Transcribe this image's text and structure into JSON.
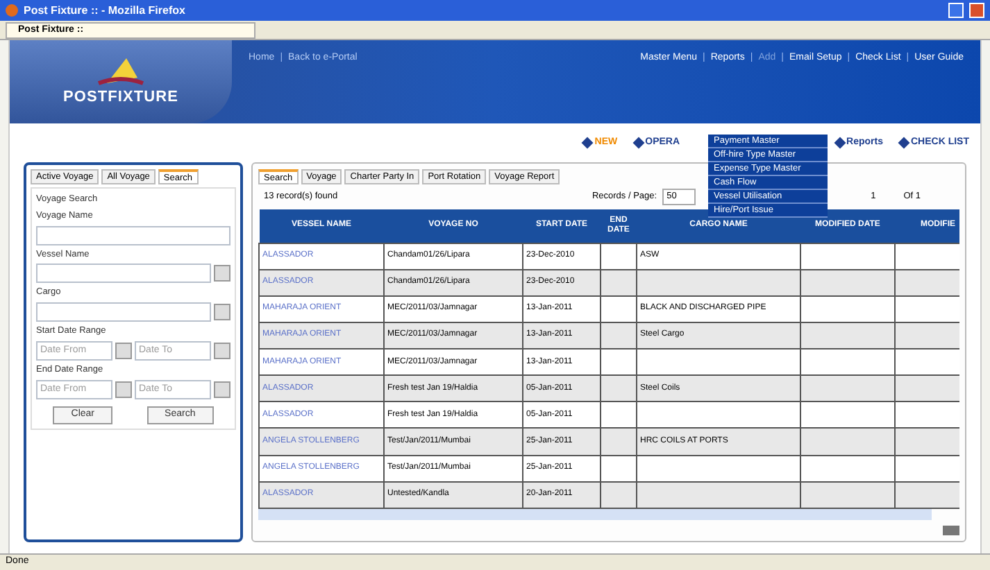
{
  "window": {
    "title": "Post Fixture :: - Mozilla Firefox"
  },
  "browser_tab": {
    "label": "Post Fixture ::"
  },
  "logo": {
    "text": "POSTFIXTURE"
  },
  "header_links": [
    {
      "label": "Home"
    },
    {
      "label": "Back to e-Portal",
      "separator": "|"
    }
  ],
  "main_menu": [
    {
      "label": "Master Menu",
      "expanded": false
    },
    {
      "label": "Reports",
      "expanded": false,
      "separator": "|"
    },
    {
      "label": "Add",
      "expanded": true,
      "separator": "|"
    },
    {
      "label": "Email Setup",
      "expanded": false,
      "separator": "|"
    },
    {
      "label": "Check List",
      "expanded": false,
      "separator": "|"
    },
    {
      "label": "User Guide",
      "expanded": false,
      "separator": "|"
    }
  ],
  "dropdown": [
    "Payment Master",
    "Off-hire Type Master",
    "Expense Type Master",
    "Cash Flow",
    "Vessel Utilisation",
    "Hire/Port Issue"
  ],
  "sub_links": [
    {
      "label": "NEW",
      "selected": true
    },
    {
      "label": "OPERA",
      "selected": false
    },
    {
      "label": "Reports",
      "selected": false
    },
    {
      "label": "CHECK LIST",
      "selected": false
    }
  ],
  "left_tabs": [
    {
      "label": "Active Voyage",
      "selected": false
    },
    {
      "label": "All Voyage",
      "selected": false
    },
    {
      "label": "Search",
      "selected": true
    }
  ],
  "search_form": {
    "legend": "Voyage Search",
    "voyage_label": "Voyage Name",
    "vessel_label": "Vessel Name",
    "cargo_label": "Cargo",
    "start_label": "Start Date Range",
    "end_label": "End Date Range",
    "start_from_placeholder": "Date From",
    "start_to_placeholder": "Date To",
    "end_from_placeholder": "Date From",
    "end_to_placeholder": "Date To",
    "buttons": [
      "Clear",
      "Search"
    ]
  },
  "right_tabs": [
    {
      "label": "Search",
      "selected": true
    },
    {
      "label": "Voyage",
      "selected": false
    },
    {
      "label": "Charter Party In",
      "selected": false
    },
    {
      "label": "Port Rotation",
      "selected": false
    },
    {
      "label": "Voyage Report",
      "selected": false
    }
  ],
  "records_found": "13 record(s) found",
  "records_per_page_label": "Records / Page:",
  "records_per_page": "50",
  "page_number": "1",
  "page_of": "Of 1",
  "table": {
    "columns": [
      "VESSEL NAME",
      "VOYAGE NO",
      "START DATE",
      "END DATE",
      "CARGO NAME",
      "MODIFIED DATE",
      "MODIFIE"
    ],
    "rows": [
      [
        "ALASSADOR",
        "Chandam01/26/Lipara",
        "23-Dec-2010",
        "",
        "ASW",
        "",
        ""
      ],
      [
        "ALASSADOR",
        "Chandam01/26/Lipara",
        "23-Dec-2010",
        "",
        "",
        "",
        ""
      ],
      [
        "MAHARAJA ORIENT",
        "MEC/2011/03/Jamnagar",
        "13-Jan-2011",
        "",
        "BLACK AND DISCHARGED PIPE",
        "",
        ""
      ],
      [
        "MAHARAJA ORIENT",
        "MEC/2011/03/Jamnagar",
        "13-Jan-2011",
        "",
        "Steel Cargo",
        "",
        ""
      ],
      [
        "MAHARAJA ORIENT",
        "MEC/2011/03/Jamnagar",
        "13-Jan-2011",
        "",
        "",
        "",
        ""
      ],
      [
        "ALASSADOR",
        "Fresh test Jan 19/Haldia",
        "05-Jan-2011",
        "",
        "Steel Coils",
        "",
        ""
      ],
      [
        "ALASSADOR",
        "Fresh test Jan 19/Haldia",
        "05-Jan-2011",
        "",
        "",
        "",
        ""
      ],
      [
        "ANGELA STOLLENBERG",
        "Test/Jan/2011/Mumbai",
        "25-Jan-2011",
        "",
        "HRC COILS AT PORTS",
        "",
        ""
      ],
      [
        "ANGELA STOLLENBERG",
        "Test/Jan/2011/Mumbai",
        "25-Jan-2011",
        "",
        "",
        "",
        ""
      ],
      [
        "ALASSADOR",
        "Untested/Kandla",
        "20-Jan-2011",
        "",
        "",
        "",
        ""
      ]
    ]
  },
  "status_bar": "Done"
}
